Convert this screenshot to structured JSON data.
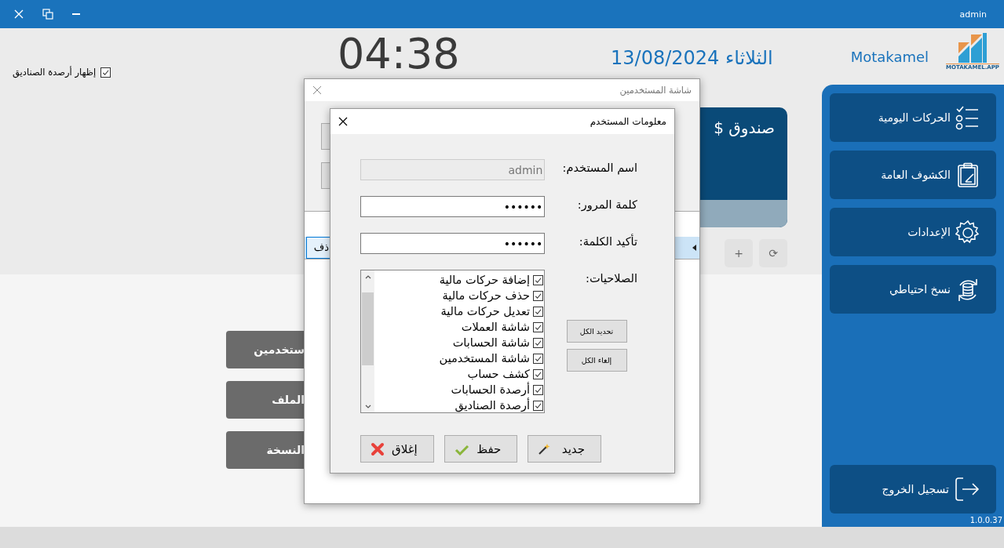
{
  "window": {
    "user": "admin"
  },
  "header": {
    "show_balances": {
      "label": "إظهار أرصدة الصناديق",
      "checked": true
    },
    "clock": "04:38",
    "date": "الثلاثاء 13/08/2024",
    "brand": "Motakamel",
    "logo_caption": "MOTAKAMEL.APP"
  },
  "cash_box": {
    "title": "صندوق $"
  },
  "box_actions": [
    "⟳",
    "+"
  ],
  "tools": [
    "ستخدمين",
    "الملف",
    "النسخة"
  ],
  "sidebar": {
    "items": [
      {
        "label": "الحركات اليومية"
      },
      {
        "label": "الكشوف العامة"
      },
      {
        "label": "الإعدادات"
      },
      {
        "label": "نسخ احتياطي"
      }
    ],
    "logout": "تسجيل الخروج",
    "version": "1.0.0.37"
  },
  "users_dialog": {
    "title": "شاشة المستخدمين",
    "rows": [
      {
        "button": "ذف",
        "selected": true
      }
    ]
  },
  "user_dialog": {
    "title": "معلومات المستخدم",
    "fields": [
      {
        "label": "اسم المستخدم:",
        "value": "admin",
        "disabled": true
      },
      {
        "label": "كلمة المرور:",
        "value": "••••••",
        "disabled": false
      },
      {
        "label": "تأكيد الكلمة:",
        "value": "••••••",
        "disabled": false
      }
    ],
    "permissions_label": "الصلاحيات:",
    "permissions": [
      {
        "label": "إضافة حركات مالية",
        "checked": true
      },
      {
        "label": "حذف حركات مالية",
        "checked": true
      },
      {
        "label": "تعديل حركات مالية",
        "checked": true
      },
      {
        "label": "شاشة العملات",
        "checked": true
      },
      {
        "label": "شاشة الحسابات",
        "checked": true
      },
      {
        "label": "شاشة المستخدمين",
        "checked": true
      },
      {
        "label": "كشف حساب",
        "checked": true
      },
      {
        "label": "أرصدة الحسابات",
        "checked": true
      },
      {
        "label": "أرصدة الصناديق",
        "checked": true
      }
    ],
    "select_all": "تحديد الكل",
    "clear_all": "إلغاء الكل",
    "buttons": [
      {
        "label": "جديد",
        "kind": "new"
      },
      {
        "label": "حفظ",
        "kind": "save"
      },
      {
        "label": "إغلاق",
        "kind": "close"
      }
    ]
  }
}
